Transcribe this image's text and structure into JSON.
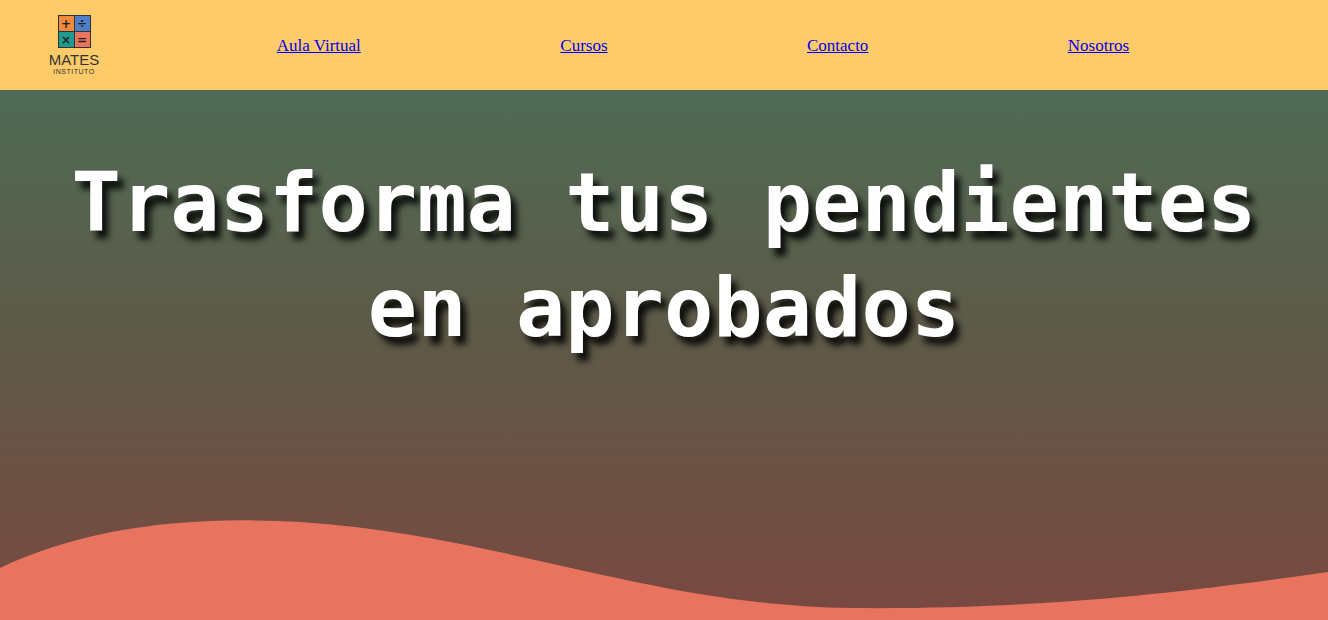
{
  "logo": {
    "symbols": [
      "+",
      "÷",
      "×",
      "="
    ],
    "name": "MATES",
    "subtitle": "INSTITUTO"
  },
  "nav": [
    {
      "label": "Aula Virtual"
    },
    {
      "label": "Cursos"
    },
    {
      "label": "Contacto"
    },
    {
      "label": "Nosotros"
    }
  ],
  "hero": {
    "title": "Trasforma tus pendientes en aprobados"
  }
}
